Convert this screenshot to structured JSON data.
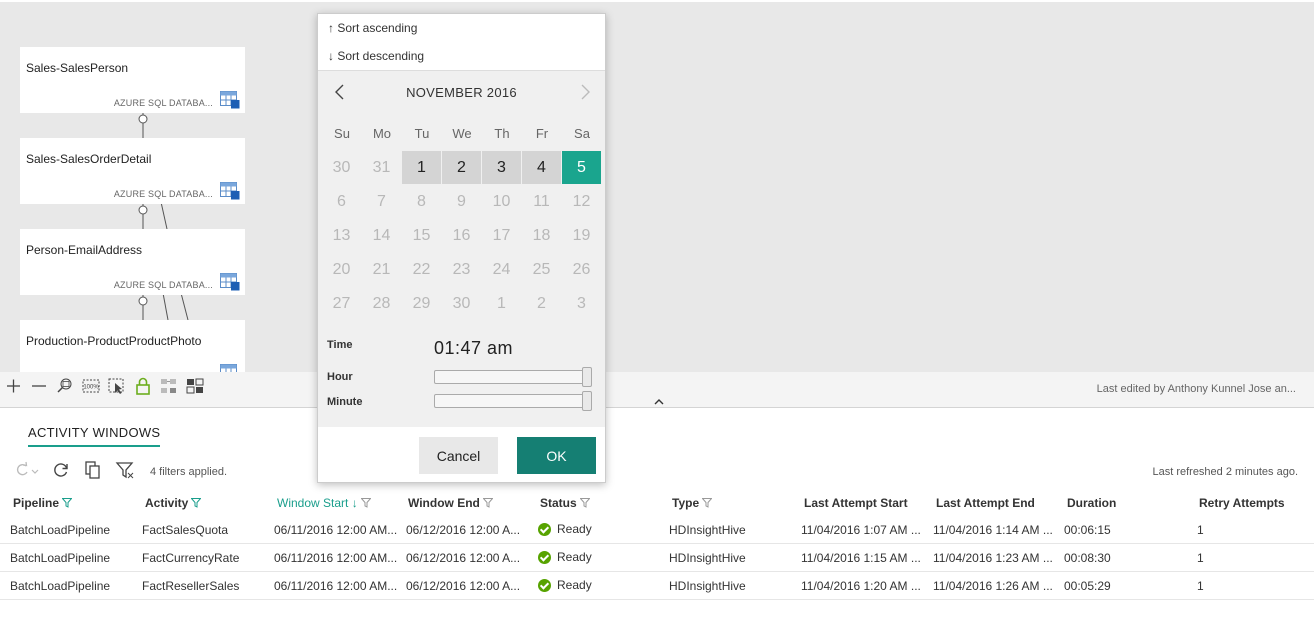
{
  "diagram": {
    "nodes": [
      {
        "name": "Sales-SalesPerson",
        "type": "AZURE SQL DATABA...",
        "icon": "sql-table-icon"
      },
      {
        "name": "Sales-SalesOrderDetail",
        "type": "AZURE SQL DATABA...",
        "icon": "sql-table-icon"
      },
      {
        "name": "Person-EmailAddress",
        "type": "AZURE SQL DATABA...",
        "icon": "sql-table-icon"
      },
      {
        "name": "Production-ProductProductPhoto",
        "type": "AZURE SQL DATABA...",
        "icon": "sql-table-icon"
      }
    ],
    "toolbar_icons": [
      "zoom-in-icon",
      "zoom-out-icon",
      "zoom-to-fit-icon",
      "zoom-100-icon",
      "fit-selection-icon",
      "select-icon",
      "lock-icon",
      "layout-icon",
      "arrange-icon"
    ],
    "last_edited": "Last edited by Anthony Kunnel Jose an..."
  },
  "sort_menu": {
    "ascending": "↑ Sort ascending",
    "descending": "↓ Sort descending"
  },
  "calendar": {
    "month_label": "NOVEMBER 2016",
    "weekdays": [
      "Su",
      "Mo",
      "Tu",
      "We",
      "Th",
      "Fr",
      "Sa"
    ],
    "weeks": [
      [
        {
          "d": "30",
          "s": "other"
        },
        {
          "d": "31",
          "s": "other"
        },
        {
          "d": "1",
          "s": "cur"
        },
        {
          "d": "2",
          "s": "cur"
        },
        {
          "d": "3",
          "s": "cur"
        },
        {
          "d": "4",
          "s": "cur"
        },
        {
          "d": "5",
          "s": "sel"
        }
      ],
      [
        {
          "d": "6",
          "s": "dis"
        },
        {
          "d": "7",
          "s": "dis"
        },
        {
          "d": "8",
          "s": "dis"
        },
        {
          "d": "9",
          "s": "dis"
        },
        {
          "d": "10",
          "s": "dis"
        },
        {
          "d": "11",
          "s": "dis"
        },
        {
          "d": "12",
          "s": "dis"
        }
      ],
      [
        {
          "d": "13",
          "s": "dis"
        },
        {
          "d": "14",
          "s": "dis"
        },
        {
          "d": "15",
          "s": "dis"
        },
        {
          "d": "16",
          "s": "dis"
        },
        {
          "d": "17",
          "s": "dis"
        },
        {
          "d": "18",
          "s": "dis"
        },
        {
          "d": "19",
          "s": "dis"
        }
      ],
      [
        {
          "d": "20",
          "s": "dis"
        },
        {
          "d": "21",
          "s": "dis"
        },
        {
          "d": "22",
          "s": "dis"
        },
        {
          "d": "23",
          "s": "dis"
        },
        {
          "d": "24",
          "s": "dis"
        },
        {
          "d": "25",
          "s": "dis"
        },
        {
          "d": "26",
          "s": "dis"
        }
      ],
      [
        {
          "d": "27",
          "s": "dis"
        },
        {
          "d": "28",
          "s": "dis"
        },
        {
          "d": "29",
          "s": "dis"
        },
        {
          "d": "30",
          "s": "dis"
        },
        {
          "d": "1",
          "s": "other"
        },
        {
          "d": "2",
          "s": "other"
        },
        {
          "d": "3",
          "s": "other"
        }
      ]
    ],
    "selected_color": "#1aa58e",
    "time_label": "Time",
    "time_value": "01:47 am",
    "hour_label": "Hour",
    "minute_label": "Minute",
    "hour_level": 1.0,
    "minute_level": 1.0,
    "cancel": "Cancel",
    "ok": "OK",
    "ok_color": "#157f73"
  },
  "activity": {
    "tab": "ACTIVITY WINDOWS",
    "filters_applied": "4 filters applied.",
    "last_refreshed": "Last refreshed 2 minutes ago.",
    "columns": [
      "Pipeline",
      "Activity",
      "Window Start ↓",
      "Window End",
      "Status",
      "Type",
      "Last Attempt Start",
      "Last Attempt End",
      "Duration",
      "Retry Attempts"
    ],
    "rows": [
      [
        "BatchLoadPipeline",
        "FactSalesQuota",
        "06/11/2016 12:00 AM...",
        "06/12/2016 12:00 A...",
        "Ready",
        "HDInsightHive",
        "11/04/2016 1:07 AM ...",
        "11/04/2016 1:14 AM ...",
        "00:06:15",
        "1"
      ],
      [
        "BatchLoadPipeline",
        "FactCurrencyRate",
        "06/11/2016 12:00 AM...",
        "06/12/2016 12:00 A...",
        "Ready",
        "HDInsightHive",
        "11/04/2016 1:15 AM ...",
        "11/04/2016 1:23 AM ...",
        "00:08:30",
        "1"
      ],
      [
        "BatchLoadPipeline",
        "FactResellerSales",
        "06/11/2016 12:00 AM...",
        "06/12/2016 12:00 A...",
        "Ready",
        "HDInsightHive",
        "11/04/2016 1:20 AM ...",
        "11/04/2016 1:26 AM ...",
        "00:05:29",
        "1"
      ]
    ],
    "status_color": "#57a300",
    "accent": "#1a9e8c"
  }
}
